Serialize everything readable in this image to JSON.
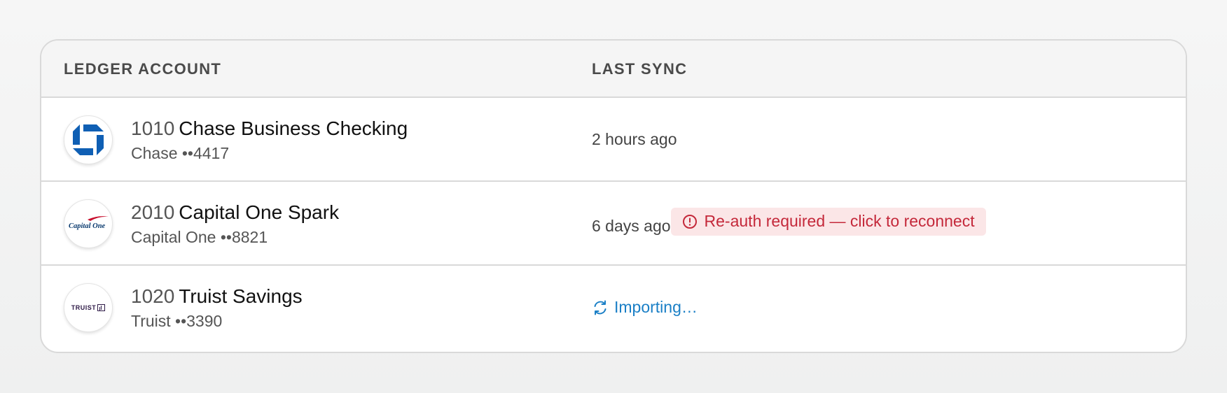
{
  "table": {
    "headers": {
      "account": "LEDGER ACCOUNT",
      "sync": "LAST SYNC"
    },
    "rows": [
      {
        "number": "1010",
        "name": "Chase Business Checking",
        "institution": "Chase ••4417",
        "logo": "chase-logo",
        "last_sync": "2 hours ago"
      },
      {
        "number": "2010",
        "name": "Capital One Spark",
        "institution": "Capital One ••8821",
        "logo": "capital-one-logo",
        "logo_text": "Capital One",
        "last_sync": "6 days ago",
        "alert": "Re-auth required — click to reconnect"
      },
      {
        "number": "1020",
        "name": "Truist Savings",
        "institution": "Truist ••3390",
        "logo": "truist-logo",
        "logo_text": "TRUIST",
        "status": "Importing…"
      }
    ]
  },
  "colors": {
    "chase_blue": "#0f5fb4",
    "alert_text": "#c4283a",
    "alert_bg": "#fbe6e7",
    "importing": "#1a7fc6"
  }
}
